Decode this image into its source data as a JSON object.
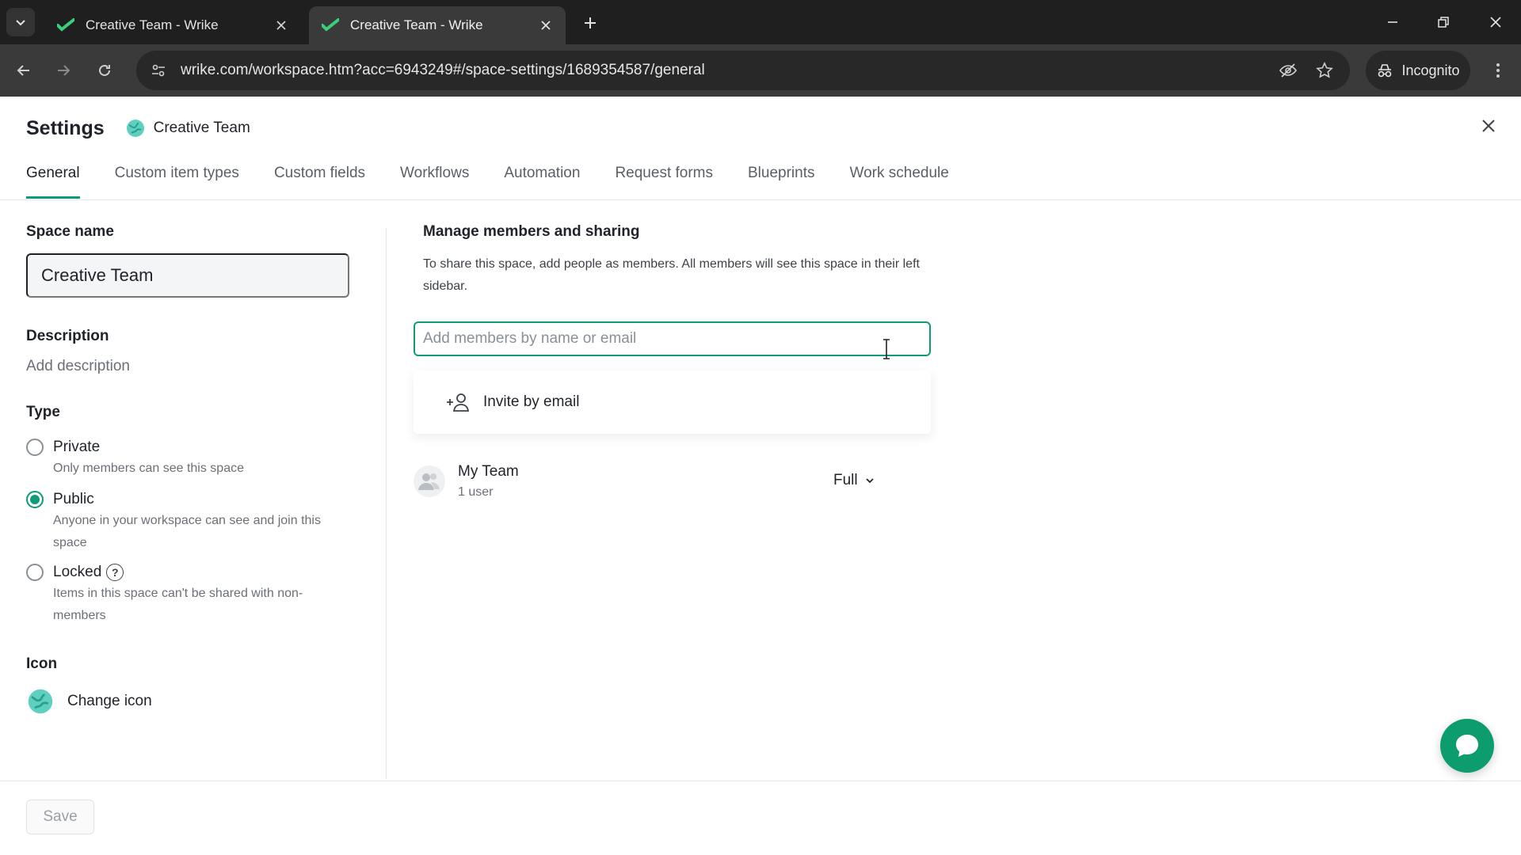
{
  "browser": {
    "tabs": [
      {
        "title": "Creative Team - Wrike",
        "active": false
      },
      {
        "title": "Creative Team - Wrike",
        "active": true
      }
    ],
    "url": "wrike.com/workspace.htm?acc=6943249#/space-settings/1689354587/general",
    "incognito_label": "Incognito"
  },
  "settings": {
    "title": "Settings",
    "space_name": "Creative Team",
    "tabs": [
      "General",
      "Custom item types",
      "Custom fields",
      "Workflows",
      "Automation",
      "Request forms",
      "Blueprints",
      "Work schedule"
    ],
    "active_tab": "General"
  },
  "left": {
    "space_name_label": "Space name",
    "space_name_value": "Creative Team",
    "description_label": "Description",
    "description_placeholder": "Add description",
    "type_label": "Type",
    "types": [
      {
        "label": "Private",
        "desc": "Only members can see this space",
        "checked": false
      },
      {
        "label": "Public",
        "desc": "Anyone in your workspace can see and join this space",
        "checked": true
      },
      {
        "label": "Locked",
        "desc": "Items in this space can't be shared with non-members",
        "checked": false
      }
    ],
    "icon_label": "Icon",
    "change_icon_label": "Change icon"
  },
  "right": {
    "title": "Manage members and sharing",
    "description": "To share this space, add people as members. All members will see this space in their left sidebar.",
    "member_input_placeholder": "Add members by name or email",
    "invite_by_email": "Invite by email",
    "team": {
      "name": "My Team",
      "count": "1 user",
      "access": "Full"
    }
  },
  "footer": {
    "save_label": "Save"
  },
  "colors": {
    "accent": "#0f9b7a",
    "chat_fab": "#0c9c6e",
    "chrome_dark": "#1f1f1f"
  }
}
